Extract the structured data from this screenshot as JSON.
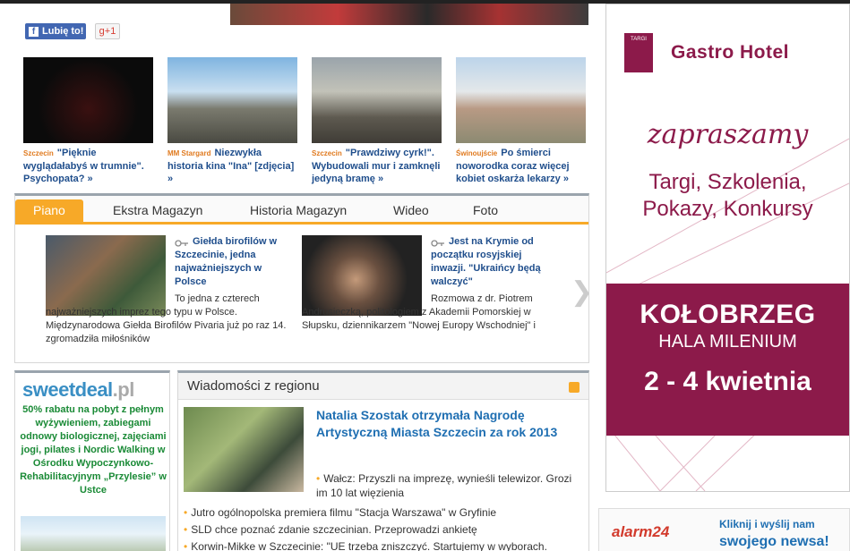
{
  "social": {
    "like_label": "Lubię to!",
    "gplus_label": "g+1"
  },
  "thumbnails": [
    {
      "tag": "Szczecin",
      "caption": "\"Pięknie wyglądałabyś w trumnie\". Psychopata? »"
    },
    {
      "tag": "MM Stargard",
      "caption": "Niezwykła historia kina \"Ina\" [zdjęcia] »"
    },
    {
      "tag": "Szczecin",
      "caption": "\"Prawdziwy cyrk!\". Wybudowali mur i zamknęli jedyną bramę »"
    },
    {
      "tag": "Świnoujście",
      "caption": "Po śmierci noworodka coraz więcej kobiet oskarża lekarzy »"
    }
  ],
  "tabs": [
    {
      "label": "Piano",
      "active": true
    },
    {
      "label": "Ekstra Magazyn"
    },
    {
      "label": "Historia Magazyn"
    },
    {
      "label": "Wideo"
    },
    {
      "label": "Foto"
    }
  ],
  "features": [
    {
      "title": "Giełda birofilów w Szczecinie, jedna najważniejszych w Polsce",
      "desc": "To jedna z czterech najważniejszych imprez tego typu w Polsce. Międzynarodowa Giełda Birofilów Pivaria już po raz 14. zgromadziła miłośników"
    },
    {
      "title": "Jest na Krymie od początku rosyjskiej inwazji. \"Ukraińcy będą walczyć\"",
      "desc": "Rozmowa z dr. Piotrem Andrusieczką, politologiem z Akademii Pomorskiej w Słupsku, dziennikarzem \"Nowej Europy Wschodniej\" i"
    }
  ],
  "sweetdeal": {
    "logo_main": "sweetdeal",
    "logo_suffix": ".pl",
    "text": "50% rabatu na pobyt z pełnym wyżywieniem, zabiegami odnowy biologicznej, zajęciami jogi, pilates i Nordic Walking w Ośrodku Wypoczynkowo-Rehabilitacyjnym „Przylesie” w Ustce"
  },
  "news": {
    "header": "Wiadomości z regionu",
    "headline": "Natalia Szostak otrzymała Nagrodę Artystyczną Miasta Szczecin za rok 2013",
    "sub": "Wałcz: Przyszli na imprezę, wynieśli telewizor. Grozi im 10 lat więzienia",
    "items": [
      "Jutro ogólnopolska premiera filmu \"Stacja Warszawa\" w Gryfinie",
      "SLD chce poznać zdanie szczecinian. Przeprowadzi ankietę",
      "Korwin-Mikke w Szczecinie: \"UE trzeba zniszczyć. Startujemy w wyborach."
    ]
  },
  "ad": {
    "logo_text": "TARGI",
    "brand": "Gastro Hotel",
    "tagline": "zapraszamy",
    "events_line1": "Targi, Szkolenia,",
    "events_line2": "Pokazy, Konkursy",
    "city": "KOŁOBRZEG",
    "venue": "HALA MILENIUM",
    "dates": "2 - 4 kwietnia"
  },
  "alarm": {
    "logo": "alarm24",
    "line1": "Kliknij i wyślij nam",
    "line2": "swojego newsa!"
  }
}
